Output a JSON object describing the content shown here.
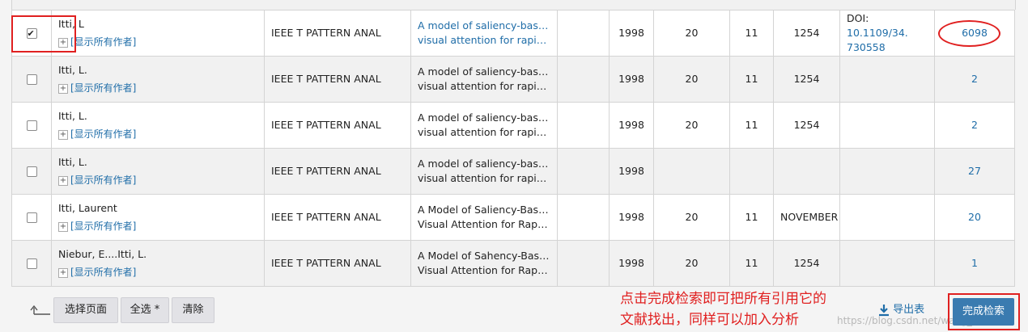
{
  "rows": [
    {
      "checked": true,
      "author": "Itti, L",
      "show_all": "[显示所有作者]",
      "source": "IEEE T PATTERN ANAL",
      "title_line1": "A model of saliency-based",
      "title_line2": "visual attention for rapid...",
      "title_linked": true,
      "year": "1998",
      "volume": "20",
      "issue": "11",
      "page": "1254",
      "doi_label": "DOI: ",
      "doi_value": "10.1109/34.",
      "doi_value2": "730558",
      "citations": "6098"
    },
    {
      "checked": false,
      "author": "Itti, L.",
      "show_all": "[显示所有作者]",
      "source": "IEEE T PATTERN ANAL",
      "title_line1": "A model of saliency-based",
      "title_line2": "visual attention for rapid...",
      "title_linked": false,
      "year": "1998",
      "volume": "20",
      "issue": "11",
      "page": "1254",
      "doi_label": "",
      "doi_value": "",
      "doi_value2": "",
      "citations": "2"
    },
    {
      "checked": false,
      "author": "Itti, L.",
      "show_all": "[显示所有作者]",
      "source": "IEEE T PATTERN ANAL",
      "title_line1": "A model of saliency-based",
      "title_line2": "visual attention for rapid...",
      "title_linked": false,
      "year": "1998",
      "volume": "20",
      "issue": "11",
      "page": "1254",
      "doi_label": "",
      "doi_value": "",
      "doi_value2": "",
      "citations": "2"
    },
    {
      "checked": false,
      "author": "Itti, L.",
      "show_all": "[显示所有作者]",
      "source": "IEEE T PATTERN ANAL",
      "title_line1": "A model of saliency-based",
      "title_line2": "visual attention for rapid...",
      "title_linked": false,
      "year": "1998",
      "volume": "",
      "issue": "",
      "page": "",
      "doi_label": "",
      "doi_value": "",
      "doi_value2": "",
      "citations": "27"
    },
    {
      "checked": false,
      "author": "Itti, Laurent",
      "show_all": "[显示所有作者]",
      "source": "IEEE T PATTERN ANAL",
      "title_line1": "A Model of Saliency-Based",
      "title_line2": "Visual Attention for Rapid...",
      "title_linked": false,
      "year": "1998",
      "volume": "20",
      "issue": "11",
      "page": "NOVEMBER",
      "doi_label": "",
      "doi_value": "",
      "doi_value2": "",
      "citations": "20"
    },
    {
      "checked": false,
      "author": "Niebur, E....Itti, L.",
      "show_all": "[显示所有作者]",
      "source": "IEEE T PATTERN ANAL",
      "title_line1": "A Model of Sahency-Based",
      "title_line2": "Visual Attention for Rapid...",
      "title_linked": false,
      "year": "1998",
      "volume": "20",
      "issue": "11",
      "page": "1254",
      "doi_label": "",
      "doi_value": "",
      "doi_value2": "",
      "citations": "1"
    }
  ],
  "footer": {
    "select_page": "选择页面",
    "select_all": "全选 *",
    "clear": "清除",
    "export": "导出表",
    "finish": "完成检索",
    "annotation_line1": "点击完成检索即可把所有引用它的",
    "annotation_line2": "文献找出，同样可以加入分析",
    "watermark": "https://blog.csdn.net/wang_xinzh"
  },
  "colors": {
    "link": "#1f6da8",
    "highlight": "#e02020",
    "primary_button": "#3a7bb0"
  }
}
